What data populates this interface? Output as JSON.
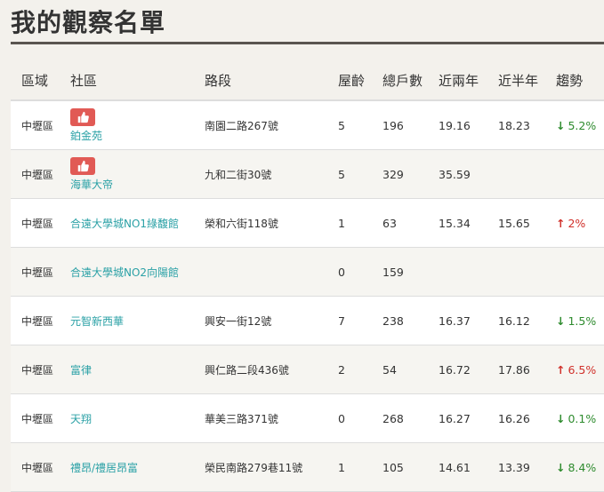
{
  "page": {
    "title": "我的觀察名單"
  },
  "columns": [
    "區域",
    "社區",
    "路段",
    "屋齡",
    "總戶數",
    "近兩年",
    "近半年",
    "趨勢"
  ],
  "rows": [
    {
      "area": "中壢區",
      "community": "鉑金苑",
      "liked": true,
      "road": "南園二路267號",
      "age": "5",
      "households": "196",
      "two_year": "19.16",
      "half_year": "18.23",
      "trend_dir": "down",
      "trend": "5.2%"
    },
    {
      "area": "中壢區",
      "community": "海華大帝",
      "liked": true,
      "road": "九和二街30號",
      "age": "5",
      "households": "329",
      "two_year": "35.59",
      "half_year": "",
      "trend_dir": "",
      "trend": ""
    },
    {
      "area": "中壢區",
      "community": "合遠大學城NO1綠馥館",
      "liked": false,
      "road": "榮和六街118號",
      "age": "1",
      "households": "63",
      "two_year": "15.34",
      "half_year": "15.65",
      "trend_dir": "up",
      "trend": "2%"
    },
    {
      "area": "中壢區",
      "community": "合遠大學城NO2向陽館",
      "liked": false,
      "road": "",
      "age": "0",
      "households": "159",
      "two_year": "",
      "half_year": "",
      "trend_dir": "",
      "trend": ""
    },
    {
      "area": "中壢區",
      "community": "元智新西華",
      "liked": false,
      "road": "興安一街12號",
      "age": "7",
      "households": "238",
      "two_year": "16.37",
      "half_year": "16.12",
      "trend_dir": "down",
      "trend": "1.5%"
    },
    {
      "area": "中壢區",
      "community": "富律",
      "liked": false,
      "road": "興仁路二段436號",
      "age": "2",
      "households": "54",
      "two_year": "16.72",
      "half_year": "17.86",
      "trend_dir": "up",
      "trend": "6.5%"
    },
    {
      "area": "中壢區",
      "community": "天翔",
      "liked": false,
      "road": "華美三路371號",
      "age": "0",
      "households": "268",
      "two_year": "16.27",
      "half_year": "16.26",
      "trend_dir": "down",
      "trend": "0.1%"
    },
    {
      "area": "中壢區",
      "community": "禮昂/禮居昂富",
      "liked": false,
      "road": "榮民南路279巷11號",
      "age": "1",
      "households": "105",
      "two_year": "14.61",
      "half_year": "13.39",
      "trend_dir": "down",
      "trend": "8.4%"
    }
  ],
  "colors": {
    "link": "#2ba1a6",
    "up": "#d0302a",
    "down": "#2e8b2e",
    "like": "#e15a55"
  }
}
